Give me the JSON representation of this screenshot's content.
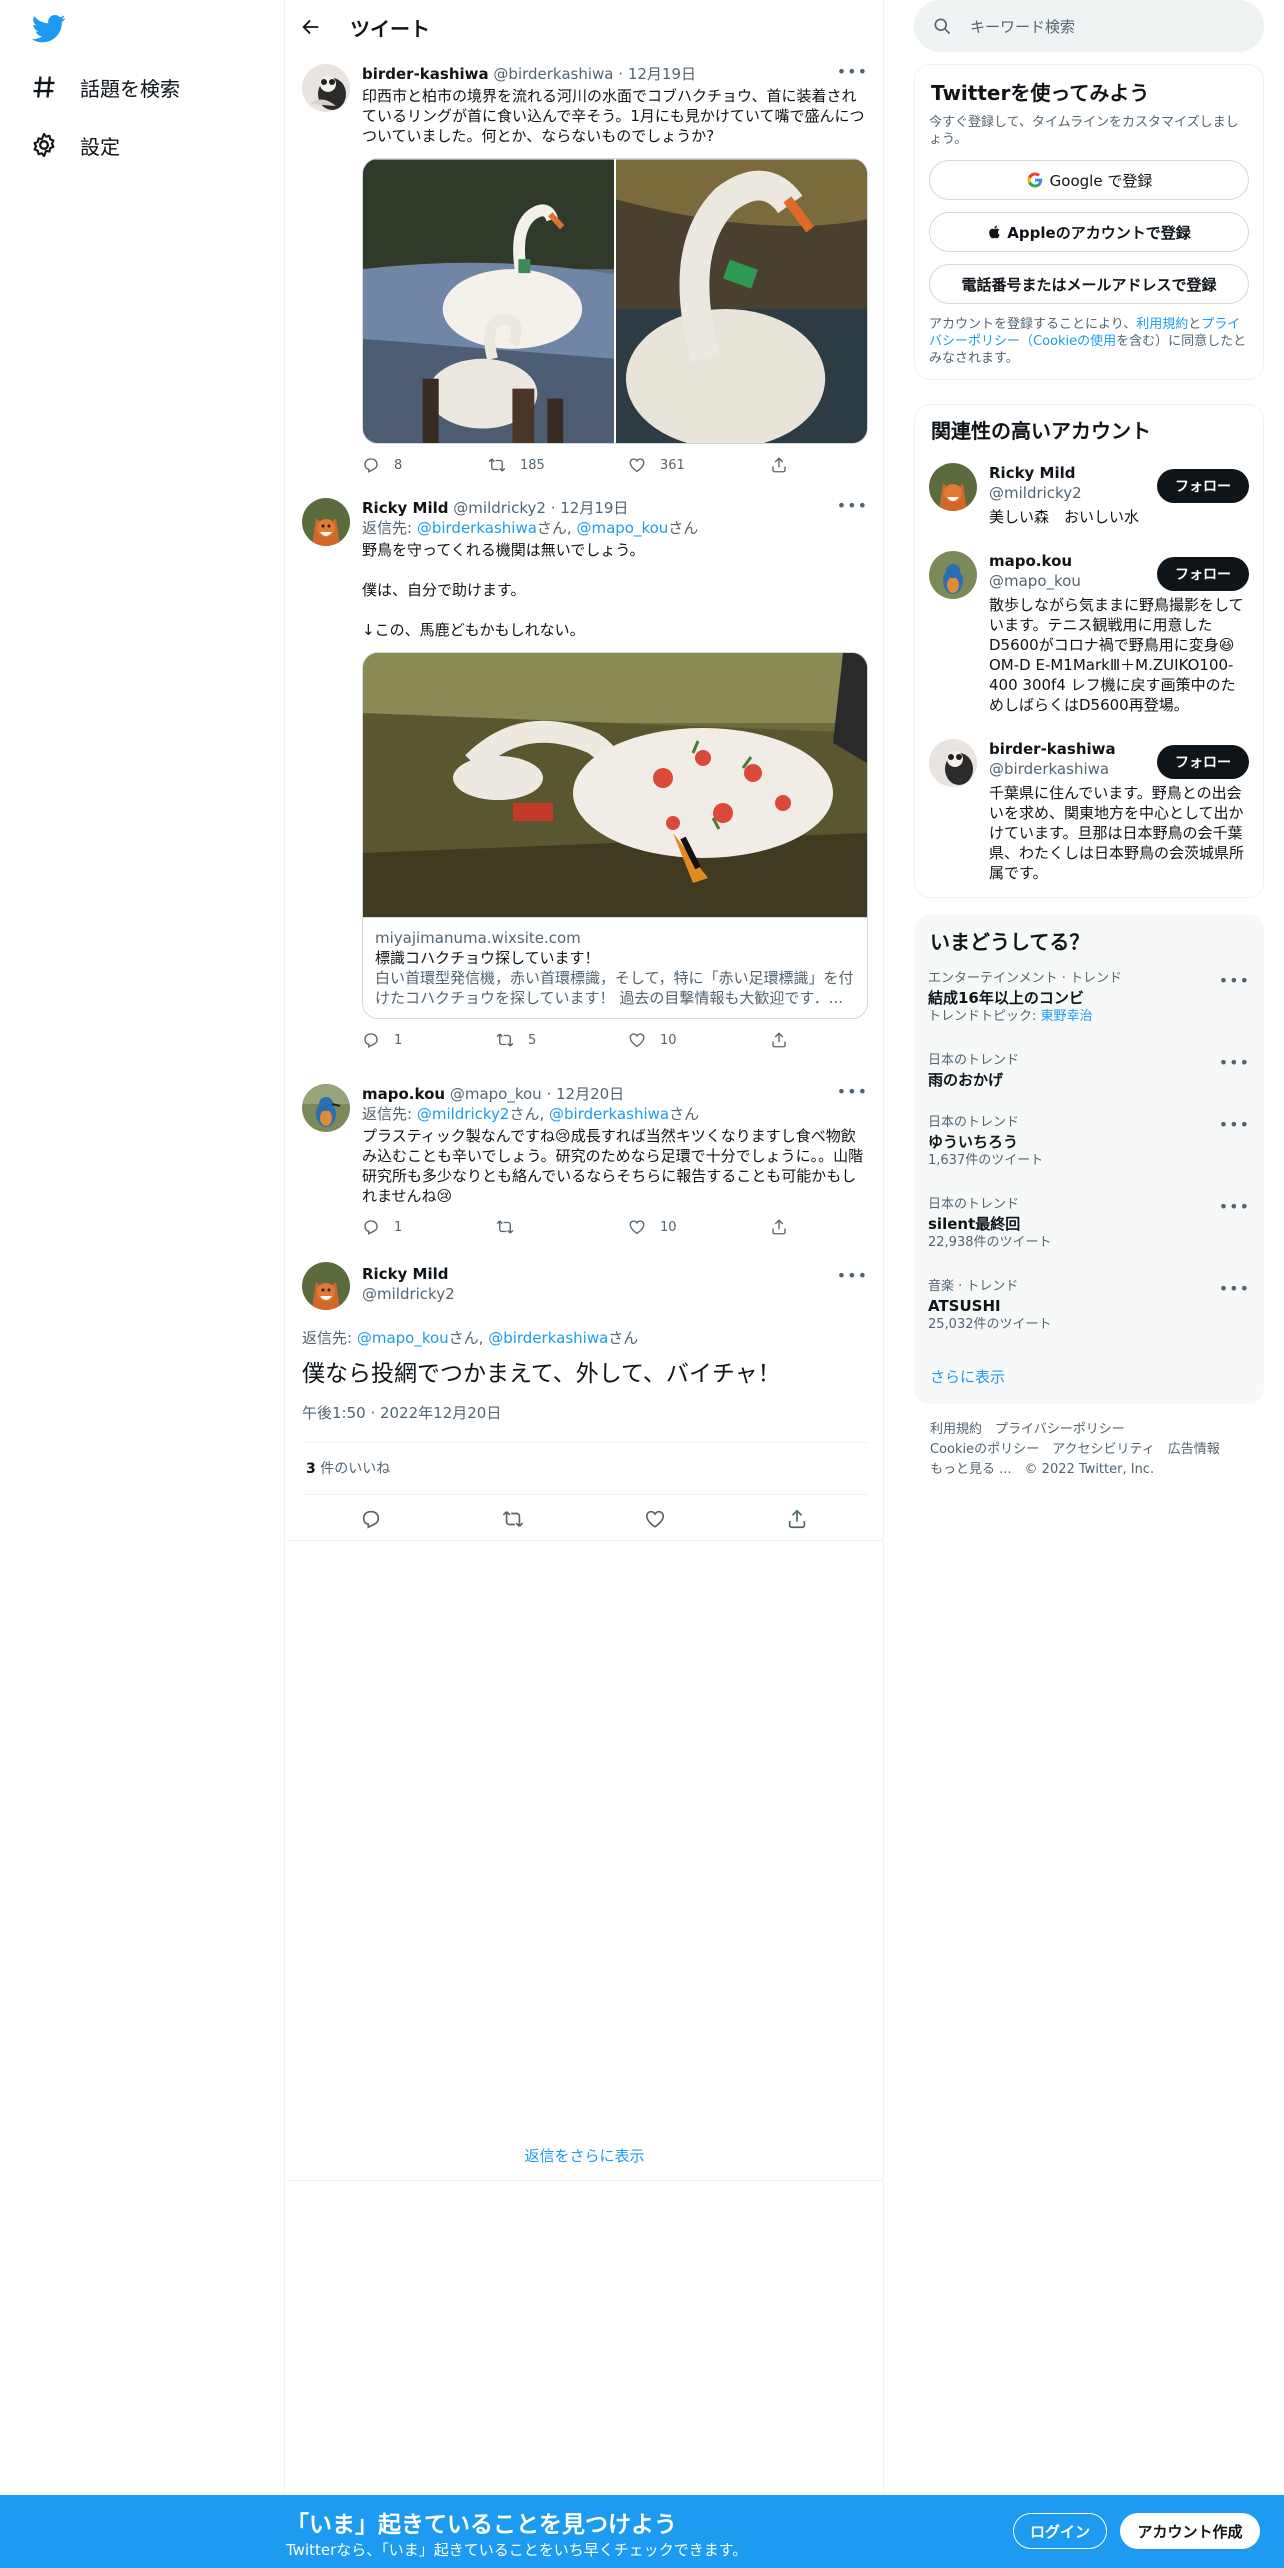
{
  "nav": {
    "explore": "話題を検索",
    "settings": "設定"
  },
  "header": {
    "title": "ツイート"
  },
  "tweets": [
    {
      "name": "birder-kashiwa",
      "handle": "@birderkashiwa",
      "date": "· 12月19日",
      "text": "印西市と柏市の境界を流れる河川の水面でコブハクチョウ、首に装着されているリングが首に食い込んで辛そう。1月にも見かけていて嘴で盛んにつついていました。何とか、ならないものでしょうか?",
      "replies": "8",
      "retweets": "185",
      "likes": "361"
    },
    {
      "name": "Ricky Mild",
      "handle": "@mildricky2",
      "date": "· 12月19日",
      "reply_prefix": "返信先: ",
      "reply_to_1": "@birderkashiwa",
      "reply_mid": "さん, ",
      "reply_to_2": "@mapo_kou",
      "reply_suffix": "さん",
      "line1": "野鳥を守ってくれる機関は無いでしょう。",
      "line2": "僕は、自分で助けます。",
      "line3": "↓この、馬鹿どもかもしれない。",
      "card_domain": "miyajimanuma.wixsite.com",
      "card_title": "標識コハクチョウ探しています！",
      "card_desc": "白い首環型発信機，赤い首環標識，そして，特に「赤い足環標識」を付けたコハクチョウを探しています！ 過去の目撃情報も大歓迎です．...",
      "replies": "1",
      "retweets": "5",
      "likes": "10"
    },
    {
      "name": "mapo.kou",
      "handle": "@mapo_kou",
      "date": "· 12月20日",
      "reply_prefix": "返信先: ",
      "reply_to_1": "@mildricky2",
      "reply_mid": "さん, ",
      "reply_to_2": "@birderkashiwa",
      "reply_suffix": "さん",
      "text": "プラスティック製なんですね😢成長すれば当然キツくなりますし食べ物飲み込むことも辛いでしょう。研究のためなら足環で十分でしょうに。。山階研究所も多少なりとも絡んでいるならそちらに報告することも可能かもしれませんね😢",
      "replies": "1",
      "retweets": "",
      "likes": "10"
    }
  ],
  "focus": {
    "name": "Ricky Mild",
    "handle": "@mildricky2",
    "reply_prefix": "返信先: ",
    "reply_to_1": "@mapo_kou",
    "reply_mid": "さん, ",
    "reply_to_2": "@birderkashiwa",
    "reply_suffix": "さん",
    "text": "僕なら投網でつかまえて、外して、バイチャ！",
    "timestamp": "午後1:50 · 2022年12月20日",
    "likes_count": "3",
    "likes_label": " 件のいいね"
  },
  "show_more_replies": "返信をさらに表示",
  "sidebar": {
    "search_placeholder": "キーワード検索",
    "signup": {
      "title": "Twitterを使ってみよう",
      "subtitle": "今すぐ登録して、タイムラインをカスタマイズしましょう。",
      "google": "Google で登録",
      "apple": "Appleのアカウントで登録",
      "phone": "電話番号またはメールアドレスで登録",
      "terms_1": "アカウントを登録することにより、",
      "terms_link1": "利用規約",
      "terms_2": "と",
      "terms_link2": "プライバシーポリシー（Cookieの使用",
      "terms_3": "を含む）に同意したとみなされます。"
    },
    "relevant": {
      "title": "関連性の高いアカウント",
      "follow_label": "フォロー",
      "accounts": [
        {
          "name": "Ricky Mild",
          "handle": "@mildricky2",
          "bio": "美しい森　おいしい水"
        },
        {
          "name": "mapo.kou",
          "handle": "@mapo_kou",
          "bio": "散歩しながら気ままに野鳥撮影をしています。テニス観戦用に用意したD5600がコロナ禍で野鳥用に変身😆 OM-D E-M1MarkⅢ＋M.ZUIKO100-400 300f4 レフ機に戻す画策中のためしばらくはD5600再登場。"
        },
        {
          "name": "birder-kashiwa",
          "handle": "@birderkashiwa",
          "bio": "千葉県に住んでいます。野鳥との出会いを求め、関東地方を中心として出かけています。旦那は日本野鳥の会千葉県、わたくしは日本野鳥の会茨城県所属です。"
        }
      ]
    },
    "trends": {
      "title": "いまどうしてる？",
      "items": [
        {
          "context": "エンターテインメント · トレンド",
          "name": "結成16年以上のコンビ",
          "extra_prefix": "トレンドトピック: ",
          "extra_link": "東野幸治"
        },
        {
          "context": "日本のトレンド",
          "name": "雨のおかげ"
        },
        {
          "context": "日本のトレンド",
          "name": "ゆういちろう",
          "extra": "1,637件のツイート"
        },
        {
          "context": "日本のトレンド",
          "name": "silent最終回",
          "extra": "22,938件のツイート"
        },
        {
          "context": "音楽 · トレンド",
          "name": "ATSUSHI",
          "extra": "25,032件のツイート"
        }
      ],
      "show_more": "さらに表示"
    },
    "footer": {
      "terms": "利用規約",
      "privacy": "プライバシーポリシー",
      "cookie": "Cookieのポリシー",
      "accessibility": "アクセシビリティ",
      "ads": "広告情報",
      "more": "もっと見る ...",
      "copyright": "© 2022 Twitter, Inc."
    }
  },
  "bottom_bar": {
    "headline": "「いま」起きていることを見つけよう",
    "sub": "Twitterなら、「いま」起きていることをいち早くチェックできます。",
    "login": "ログイン",
    "signup": "アカウント作成"
  },
  "colors": {
    "accent": "#1d9bf0",
    "text": "#0f1419",
    "muted": "#536471",
    "border": "#eff3f4"
  },
  "icons": [
    "twitter-logo-icon",
    "hashtag-icon",
    "gear-icon",
    "back-arrow-icon",
    "search-icon",
    "reply-icon",
    "retweet-icon",
    "like-icon",
    "share-icon",
    "more-icon",
    "google-icon",
    "apple-icon"
  ]
}
